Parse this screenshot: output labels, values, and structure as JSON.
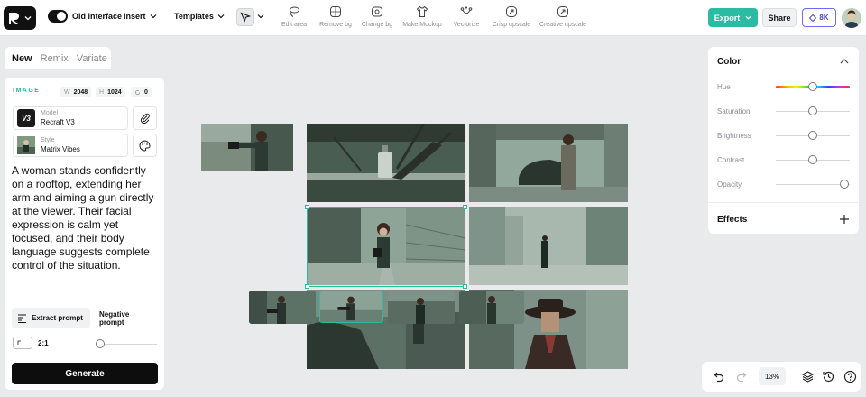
{
  "topbar": {
    "interface_toggle_label": "Old interface",
    "insert_label": "Insert",
    "templates_label": "Templates",
    "tools": [
      {
        "icon": "lasso-icon",
        "label": "Edit area"
      },
      {
        "icon": "remove-bg-icon",
        "label": "Remove bg"
      },
      {
        "icon": "change-bg-icon",
        "label": "Change bg"
      },
      {
        "icon": "shirt-icon",
        "label": "Make Mockup"
      },
      {
        "icon": "vectorize-icon",
        "label": "Vectorize"
      },
      {
        "icon": "crisp-upscale-icon",
        "label": "Crisp upscale"
      },
      {
        "icon": "creative-upscale-icon",
        "label": "Creative upscale"
      }
    ],
    "export_label": "Export",
    "share_label": "Share",
    "credits_label": "8K",
    "accent_color": "#2abba3"
  },
  "left_panel": {
    "tabs": [
      "New",
      "Remix",
      "Variate"
    ],
    "active_tab": "New",
    "image_heading": "IMAGE",
    "width_key": "W",
    "width_value": "2048",
    "height_key": "H",
    "height_value": "1024",
    "count_value": "0",
    "model_key": "Model",
    "model_value": "Recraft V3",
    "model_badge": "V3",
    "style_key": "Style",
    "style_value": "Matrix Vibes",
    "prompt": "A woman stands confidently on a rooftop, extending her arm and aiming a gun directly at the viewer. Their facial expression is calm yet focused, and their body language suggests complete control of the situation.",
    "extract_prompt_label": "Extract prompt",
    "negative_prompt_label": "Negative prompt",
    "ratio_label": "2:1",
    "generate_label": "Generate"
  },
  "right_panel": {
    "color_title": "Color",
    "adjustments": [
      {
        "label": "Hue",
        "value": 0.5
      },
      {
        "label": "Saturation",
        "value": 0.5
      },
      {
        "label": "Brightness",
        "value": 0.5
      },
      {
        "label": "Contrast",
        "value": 0.5
      },
      {
        "label": "Opacity",
        "value": 1.0
      }
    ],
    "effects_title": "Effects"
  },
  "bottom_controls": {
    "zoom": "13%"
  }
}
